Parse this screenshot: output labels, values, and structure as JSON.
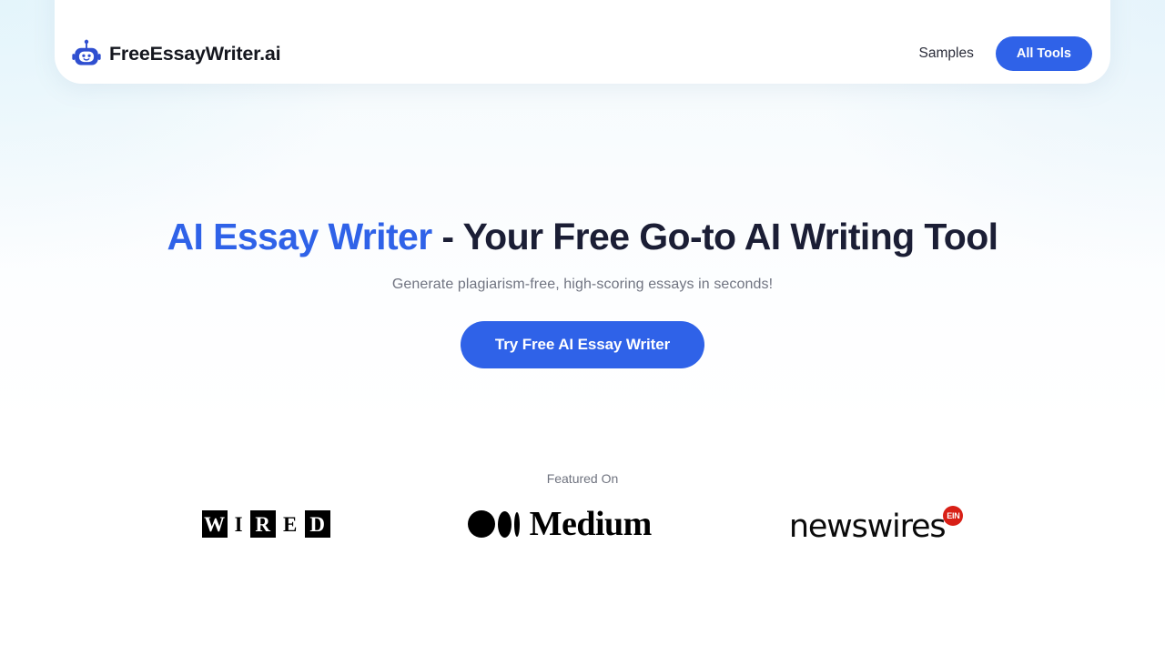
{
  "theme": {
    "accent_blue": "#2f62e8",
    "heading_dark": "#1b1e35",
    "muted_text": "#707481",
    "badge_red": "#d81f16",
    "page_bg": "#ffffff",
    "bg_tint": "#f2fafd"
  },
  "header": {
    "brand": {
      "icon": "robot-head-icon",
      "name": "FreeEssayWriter.ai"
    },
    "nav": {
      "samples_label": "Samples",
      "all_tools_label": "All Tools"
    }
  },
  "hero": {
    "title_accent": "AI Essay Writer",
    "title_rest": " - Your Free Go-to AI Writing Tool",
    "subtitle": "Generate plagiarism-free, high-scoring essays in seconds!",
    "cta_label": "Try Free AI Essay Writer"
  },
  "featured": {
    "label": "Featured On",
    "logos": [
      {
        "name": "WIRED",
        "type": "wired",
        "cells": [
          {
            "char": "W",
            "style": "on"
          },
          {
            "char": "I",
            "style": "off"
          },
          {
            "char": "R",
            "style": "on"
          },
          {
            "char": "E",
            "style": "off"
          },
          {
            "char": "D",
            "style": "on"
          }
        ]
      },
      {
        "name": "Medium",
        "type": "medium",
        "wordmark": "Medium"
      },
      {
        "name": "Newswires",
        "type": "newswires",
        "wordmark": "newswires",
        "badge": "EIN"
      }
    ]
  }
}
